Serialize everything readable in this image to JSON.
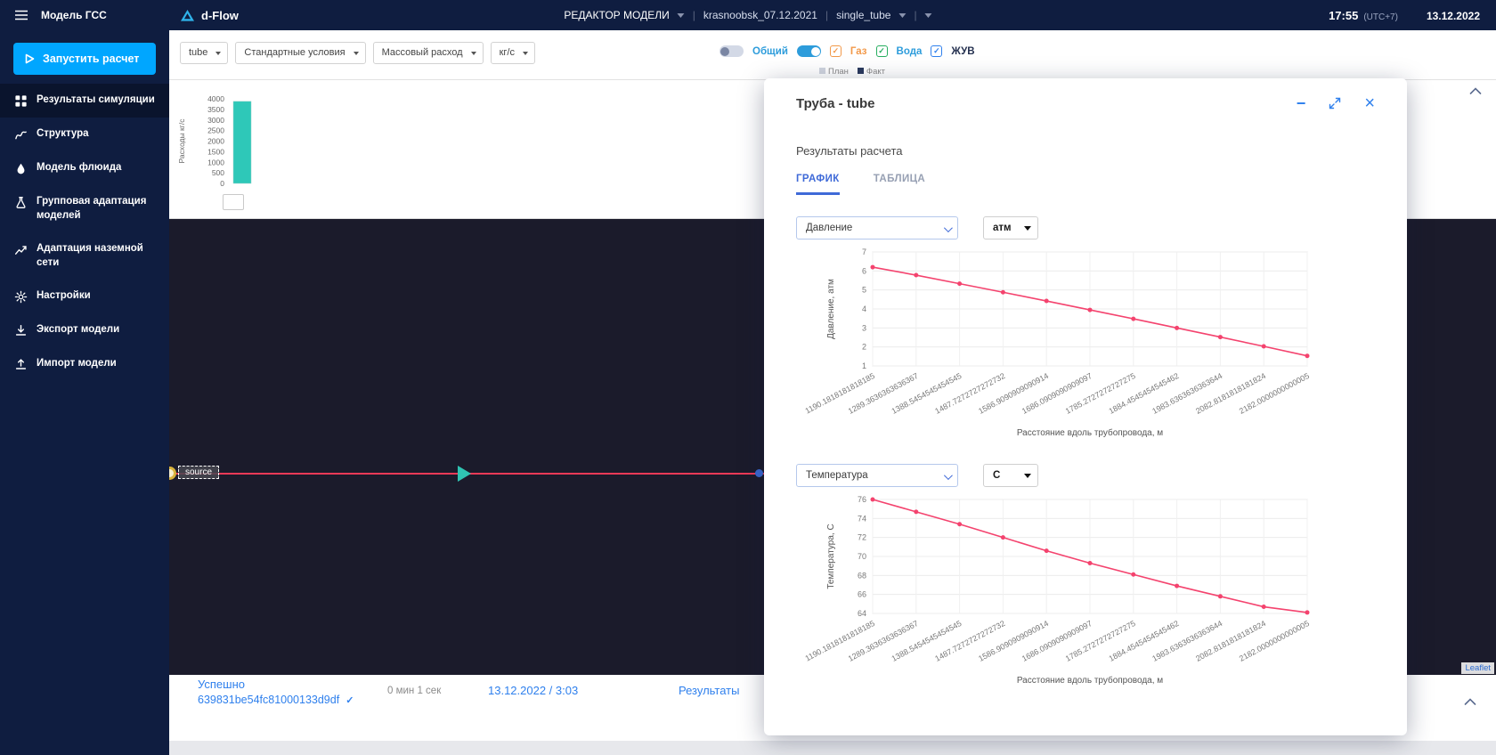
{
  "topbar": {
    "section_title": "Модель ГСС",
    "logo_text": "d-Flow",
    "editor_title": "РЕДАКТОР МОДЕЛИ",
    "separator": "|",
    "model_name": "krasnoobsk_07.12.2021",
    "submodel_name": "single_tube",
    "time": "17:55",
    "utc": "(UTC+7)",
    "date": "13.12.2022"
  },
  "sidebar": {
    "run_button_label": "Запустить расчет",
    "items": [
      {
        "label": "Результаты симуляции",
        "icon": "grid-icon",
        "active": true
      },
      {
        "label": "Структура",
        "icon": "structure-icon",
        "active": false
      },
      {
        "label": "Модель флюида",
        "icon": "fluid-icon",
        "active": false
      },
      {
        "label": "Групповая адаптация моделей",
        "icon": "group-adaptation-icon",
        "active": false
      },
      {
        "label": "Адаптация наземной сети",
        "icon": "network-adaptation-icon",
        "active": false
      },
      {
        "label": "Настройки",
        "icon": "settings-icon",
        "active": false
      },
      {
        "label": "Экспорт модели",
        "icon": "export-icon",
        "active": false
      },
      {
        "label": "Импорт модели",
        "icon": "import-icon",
        "active": false
      }
    ]
  },
  "toolbar": {
    "selects": [
      {
        "value": "tube"
      },
      {
        "value": "Стандартные условия"
      },
      {
        "value": "Массовый расход"
      },
      {
        "value": "кг/с"
      }
    ],
    "total_toggle_label": "Общий",
    "phase_checkboxes": [
      {
        "label": "Газ",
        "color": "#f2994a"
      },
      {
        "label": "Вода",
        "color": "#27ae60",
        "label_color": "#2d9cdb"
      },
      {
        "label": "ЖУВ",
        "color": "#2f80ed",
        "label_color": "#24304f"
      }
    ],
    "legend_plan": "План",
    "legend_fact": "Факт"
  },
  "canvas": {
    "source_label": "source",
    "attribution": "Leaflet"
  },
  "statusbar": {
    "status": "Успешно",
    "run_id": "639831be54fc81000133d9df",
    "duration": "0 мин 1 сек",
    "datetime": "13.12.2022 / 3:03",
    "results_link": "Результаты"
  },
  "modal": {
    "title": "Труба - tube",
    "section_title": "Результаты расчета",
    "tabs": [
      {
        "label": "ГРАФИК",
        "active": true
      },
      {
        "label": "ТАБЛИЦА",
        "active": false
      }
    ],
    "pressure_select": "Давление",
    "pressure_unit": "атм",
    "temperature_select": "Температура",
    "temperature_unit": "C"
  },
  "chart_data": [
    {
      "id": "flow-bar-chart",
      "type": "bar",
      "ylabel": "Расходы кг/с",
      "categories": [
        ""
      ],
      "values": [
        3880
      ],
      "ylim": [
        0,
        4000
      ],
      "yticks": [
        0,
        500,
        1000,
        1500,
        2000,
        2500,
        3000,
        3500,
        4000
      ],
      "bar_color": "#2ec8b8",
      "grid": false
    },
    {
      "id": "pressure-chart",
      "type": "line",
      "xlabel": "Расстояние вдоль трубопровода, м",
      "ylabel": "Давление, атм",
      "x_labels": [
        "1190.1818181818185",
        "1289.3636363636367",
        "1388.5454545454545",
        "1487.7272727272732",
        "1586.9090909090914",
        "1686.0909090909097",
        "1785.2727272727275",
        "1884.4545454545462",
        "1983.6363636363644",
        "2082.8181818181824",
        "2182.0000000000005"
      ],
      "y": [
        6.2,
        5.78,
        5.33,
        4.88,
        4.42,
        3.95,
        3.48,
        3.0,
        2.52,
        2.03,
        1.53
      ],
      "ylim": [
        1,
        7
      ],
      "yticks": [
        1,
        2,
        3,
        4,
        5,
        6,
        7
      ],
      "line_color": "#f4436e",
      "grid": true,
      "legend": "none"
    },
    {
      "id": "temperature-chart",
      "type": "line",
      "xlabel": "Расстояние вдоль трубопровода, м",
      "ylabel": "Температура, C",
      "x_labels": [
        "1190.1818181818185",
        "1289.3636363636367",
        "1388.5454545454545",
        "1487.7272727272732",
        "1586.9090909090914",
        "1686.0909090909097",
        "1785.2727272727275",
        "1884.4545454545462",
        "1983.6363636363644",
        "2082.8181818181824",
        "2182.0000000000005"
      ],
      "y": [
        76.0,
        74.7,
        73.4,
        72.0,
        70.6,
        69.3,
        68.1,
        66.9,
        65.8,
        64.7,
        64.1
      ],
      "ylim": [
        64,
        76
      ],
      "yticks": [
        64,
        66,
        68,
        70,
        72,
        74,
        76
      ],
      "line_color": "#f4436e",
      "grid": true,
      "legend": "none"
    }
  ]
}
